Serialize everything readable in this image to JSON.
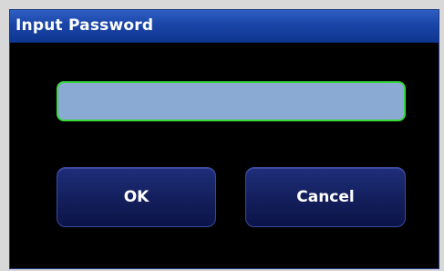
{
  "dialog": {
    "title": "Input Password",
    "password_field": {
      "value": "",
      "placeholder": ""
    },
    "ok_label": "OK",
    "cancel_label": "Cancel"
  },
  "colors": {
    "title_bar": "#1a45a8",
    "dialog_background": "#000000",
    "field_background": "#8aaad4",
    "field_border": "#38d838",
    "button_background": "#14205e",
    "button_text": "#ffffff"
  }
}
